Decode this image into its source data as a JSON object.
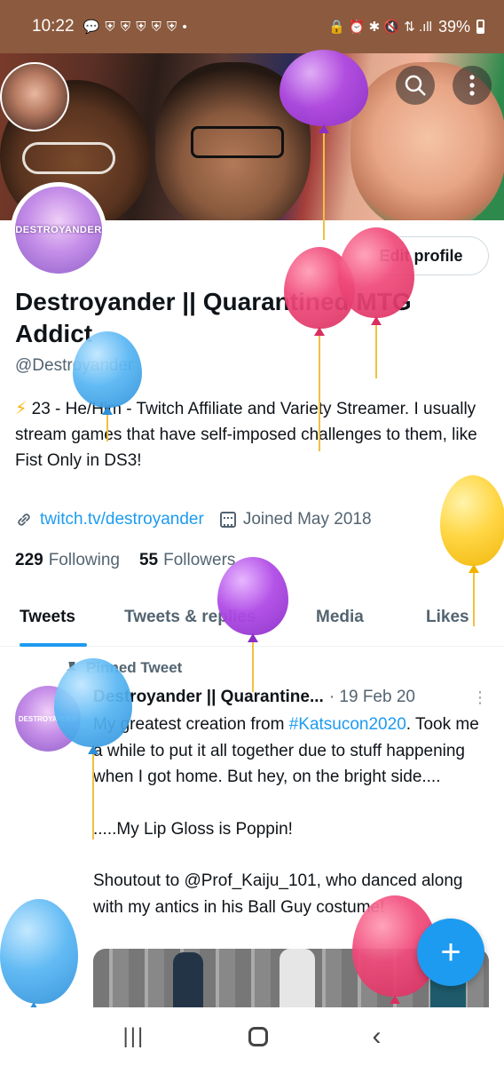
{
  "status_bar": {
    "time": "10:22",
    "notification_icons": "💬 ⛨ ⛨ ⛨ ⛨ ⛨ •",
    "system_icons": "🔒 ⏰ ✱ 🔇 ⇅ .ıll",
    "battery": "39%"
  },
  "header": {
    "search_icon": "⚲",
    "more_icon": "⋮"
  },
  "profile": {
    "avatar_text": "DESTROYANDER",
    "edit_button": "Edit profile",
    "name": "Destroyander || Quarantined MTG Addict",
    "handle": "@Destroyander",
    "bio": "23 - He/Him - Twitch Affiliate and Variety Streamer. I usually stream games that have self-imposed challenges to them, like Fist Only in DS3!",
    "bio_emoji": "⚡",
    "link": "twitch.tv/destroyander",
    "joined": "Joined May 2018",
    "following_count": "229",
    "following_label": "Following",
    "followers_count": "55",
    "followers_label": "Followers"
  },
  "tabs": [
    "Tweets",
    "Tweets & replies",
    "Media",
    "Likes"
  ],
  "active_tab": "Tweets",
  "tweet": {
    "pinned_label": "Pinned Tweet",
    "avatar_text": "DESTROYANDER",
    "author": "Destroyander || Quarantine...",
    "date": "· 19 Feb 20",
    "more_icon": "⋮",
    "body_before_tag": "My greatest creation from ",
    "hashtag": "#Katsucon2020",
    "body_after_tag": ". Took me a while to put it all together due to stuff happening when I got home. But hey, on the bright side....",
    "line2": ".....My Lip Gloss is Poppin!",
    "line3": "Shoutout to @Prof_Kaiju_101, who danced along with my antics in his Ball Guy costume!"
  },
  "fab_label": "+",
  "nav": {
    "recent": "|||",
    "back": "‹"
  },
  "colors": {
    "accent": "#1d9bf0",
    "status_bar": "#8c5a3e",
    "text_primary": "#0f1419",
    "text_secondary": "#536471"
  }
}
